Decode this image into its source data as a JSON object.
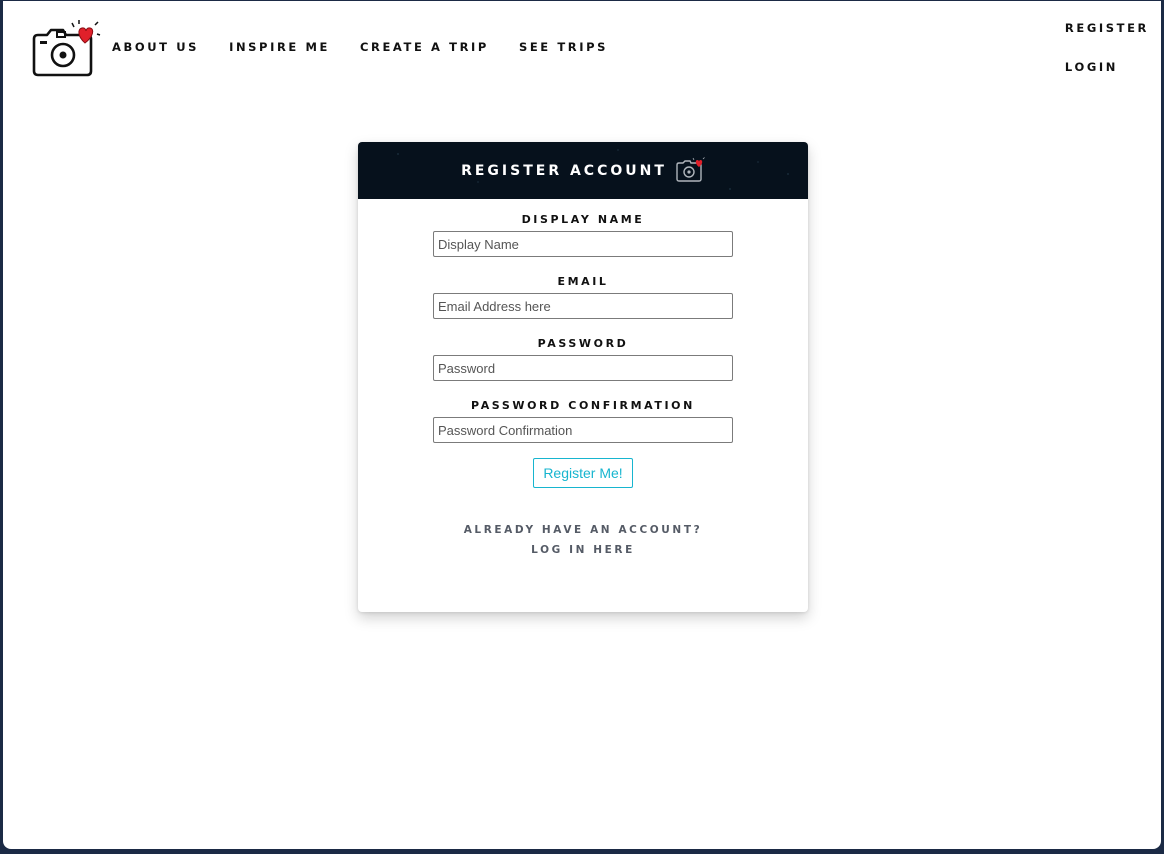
{
  "header": {
    "logo_icon": "camera-heart-icon",
    "nav": [
      {
        "label": "ABOUT US"
      },
      {
        "label": "INSPIRE ME"
      },
      {
        "label": "CREATE A TRIP"
      },
      {
        "label": "SEE TRIPS"
      }
    ],
    "auth": {
      "register_label": "REGISTER",
      "login_label": "LOGIN"
    }
  },
  "card": {
    "title": "REGISTER ACCOUNT",
    "title_icon": "camera-heart-icon",
    "fields": [
      {
        "label": "DISPLAY NAME",
        "placeholder": "Display Name",
        "value": ""
      },
      {
        "label": "EMAIL",
        "placeholder": "Email Address here",
        "value": ""
      },
      {
        "label": "PASSWORD",
        "placeholder": "Password",
        "value": ""
      },
      {
        "label": "PASSWORD CONFIRMATION",
        "placeholder": "Password Confirmation",
        "value": ""
      }
    ],
    "submit_label": "Register Me!",
    "login_prompt": "ALREADY HAVE AN ACCOUNT?",
    "login_link": "LOG IN HERE"
  },
  "colors": {
    "accent": "#17b5cf",
    "header_bg": "#06111c",
    "heart": "#e0202a"
  }
}
